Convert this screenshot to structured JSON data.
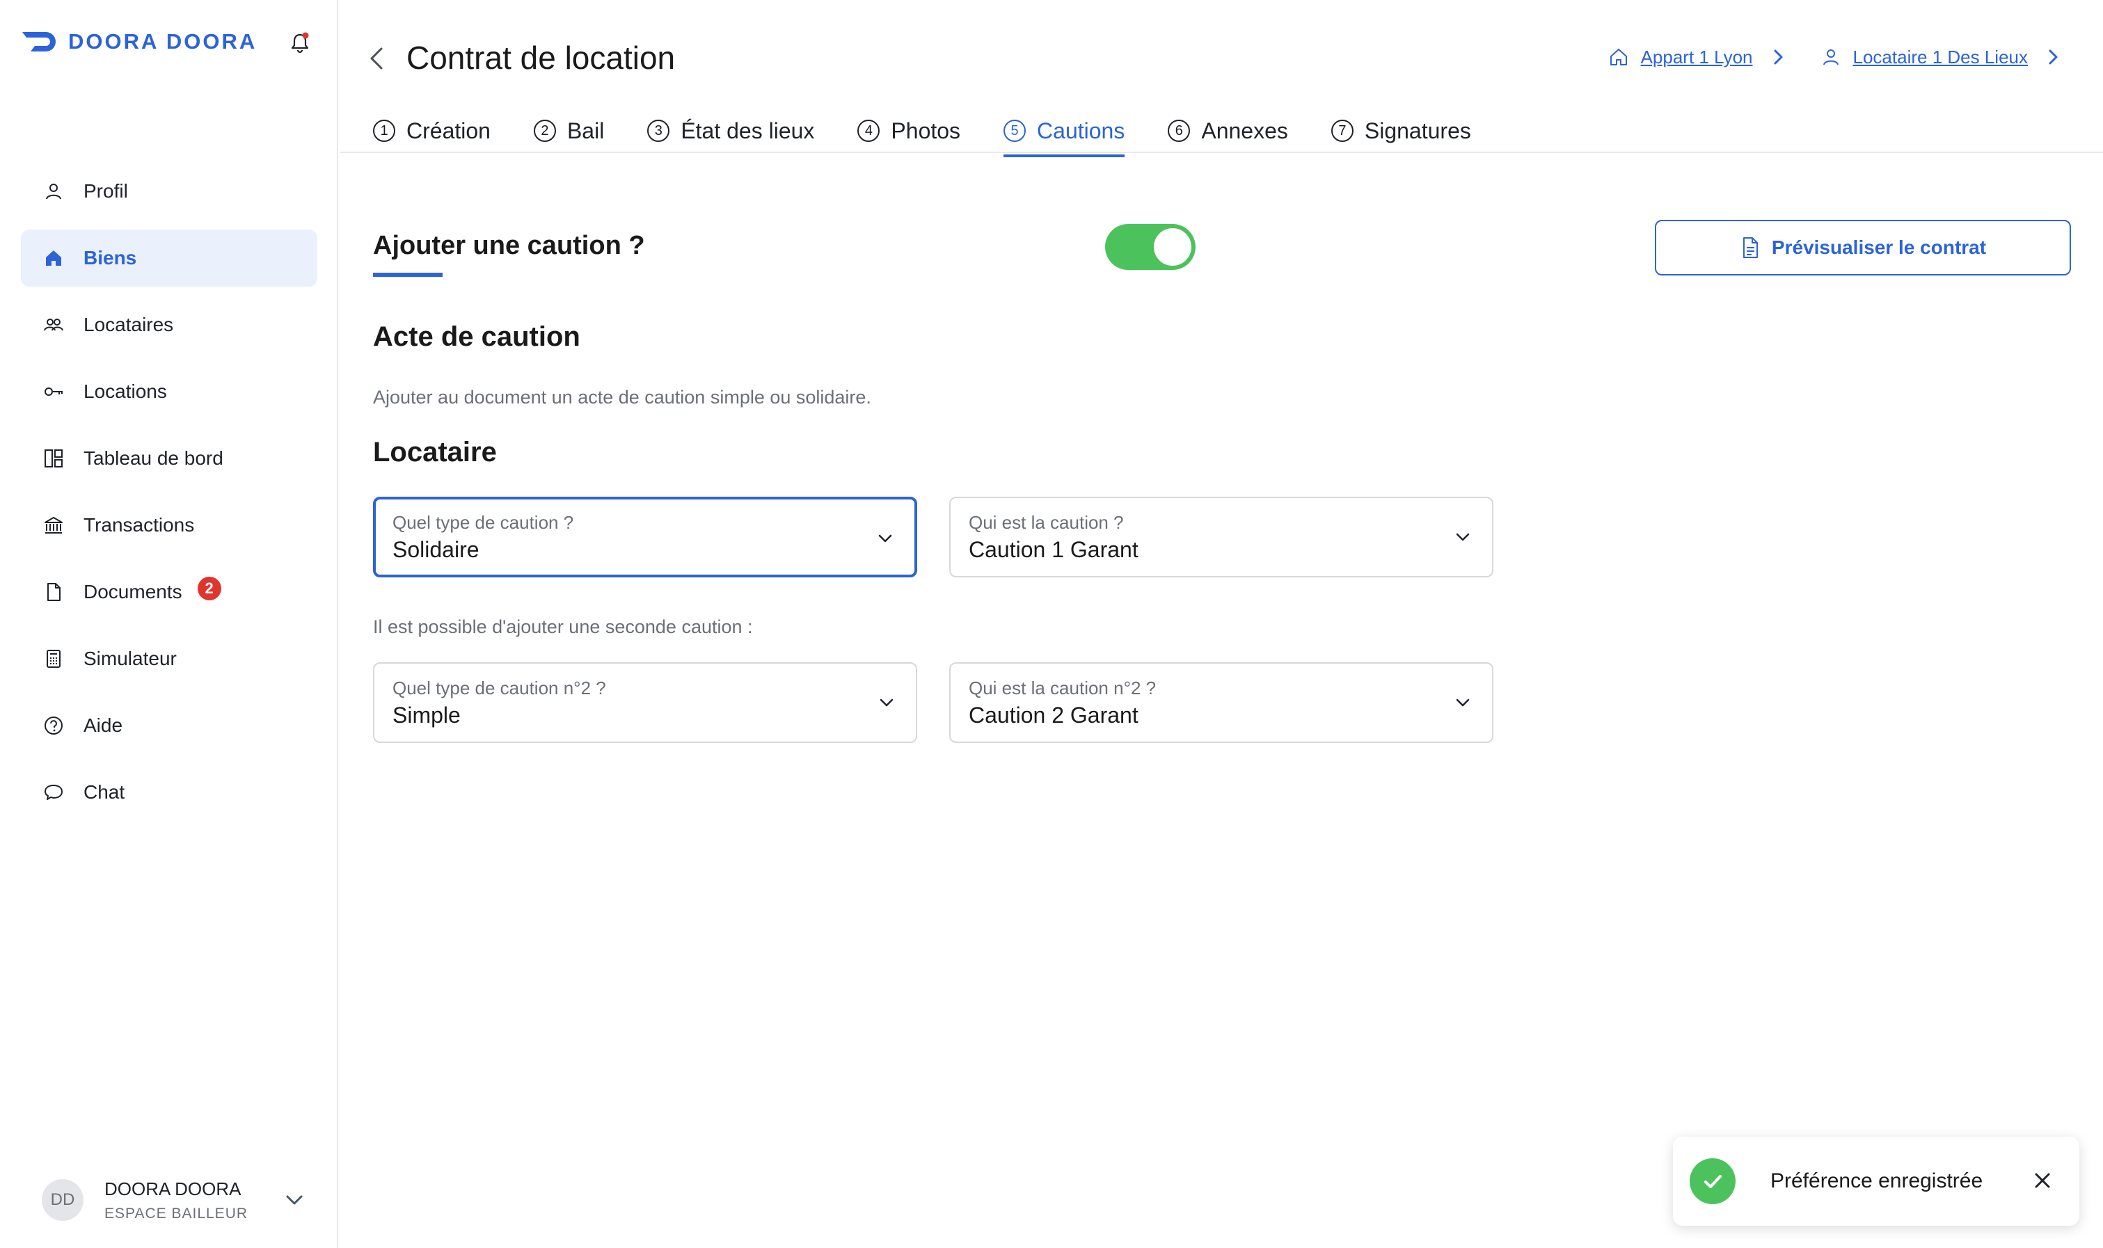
{
  "brand": {
    "name": "DOORA DOORA",
    "accent": "#2b63d9",
    "success": "#4cc25c",
    "danger": "#e0342c"
  },
  "sidebar": {
    "items": [
      {
        "label": "Profil",
        "icon": "user-icon",
        "active": false
      },
      {
        "label": "Biens",
        "icon": "home-icon",
        "active": true
      },
      {
        "label": "Locataires",
        "icon": "users-icon",
        "active": false
      },
      {
        "label": "Locations",
        "icon": "key-icon",
        "active": false
      },
      {
        "label": "Tableau de bord",
        "icon": "dashboard-icon",
        "active": false
      },
      {
        "label": "Transactions",
        "icon": "bank-icon",
        "active": false
      },
      {
        "label": "Documents",
        "icon": "document-icon",
        "active": false,
        "badge": "2"
      },
      {
        "label": "Simulateur",
        "icon": "calculator-icon",
        "active": false
      },
      {
        "label": "Aide",
        "icon": "help-icon",
        "active": false
      },
      {
        "label": "Chat",
        "icon": "chat-icon",
        "active": false
      }
    ],
    "user": {
      "initials": "DD",
      "name": "DOORA DOORA",
      "role": "ESPACE BAILLEUR"
    }
  },
  "header": {
    "title": "Contrat de location",
    "breadcrumbs": [
      {
        "label": "Appart 1 Lyon",
        "icon": "home-outline-icon"
      },
      {
        "label": "Locataire 1 Des Lieux",
        "icon": "user-icon"
      }
    ]
  },
  "tabs": [
    {
      "num": "1",
      "label": "Création",
      "active": false
    },
    {
      "num": "2",
      "label": "Bail",
      "active": false
    },
    {
      "num": "3",
      "label": "État des lieux",
      "active": false
    },
    {
      "num": "4",
      "label": "Photos",
      "active": false
    },
    {
      "num": "5",
      "label": "Cautions",
      "active": true
    },
    {
      "num": "6",
      "label": "Annexes",
      "active": false
    },
    {
      "num": "7",
      "label": "Signatures",
      "active": false
    }
  ],
  "content": {
    "toggle_question": "Ajouter une caution ?",
    "toggle_on": true,
    "preview_button": "Prévisualiser le contrat",
    "acte_title": "Acte de caution",
    "acte_desc": "Ajouter au document un acte de caution simple ou solidaire.",
    "locataire_title": "Locataire",
    "second_hint": "Il est possible d'ajouter une seconde caution :",
    "selects": [
      {
        "label": "Quel type de caution ?",
        "value": "Solidaire"
      },
      {
        "label": "Qui est la caution ?",
        "value": "Caution 1 Garant"
      },
      {
        "label": "Quel type de caution n°2 ?",
        "value": "Simple"
      },
      {
        "label": "Qui est la caution n°2 ?",
        "value": "Caution 2 Garant"
      }
    ]
  },
  "toast": {
    "message": "Préférence enregistrée"
  }
}
